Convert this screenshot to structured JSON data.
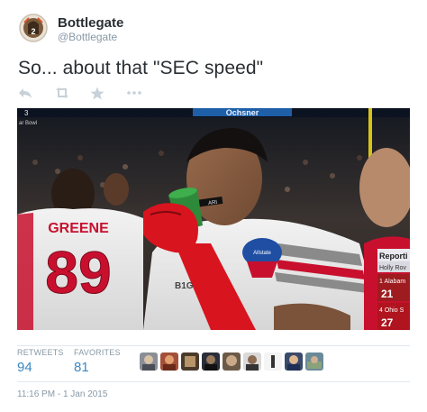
{
  "author": {
    "display_name": "Bottlegate",
    "handle": "@Bottlegate",
    "avatar_icon": "bottle-cap-avatar-icon"
  },
  "tweet": {
    "text": "So... about that \"SEC speed\"",
    "timestamp": "11:16 PM - 1 Jan 2015"
  },
  "actions": [
    {
      "name": "reply-icon"
    },
    {
      "name": "retweet-icon"
    },
    {
      "name": "favorite-icon"
    },
    {
      "name": "more-icon"
    }
  ],
  "media": {
    "stadium_sign": "Ochsner",
    "scoreboard_text": "3",
    "scoreboard_sub": "ar Bowl",
    "jersey_name": "GREENE",
    "jersey_number": "89",
    "eye_black_text": "ARI",
    "sleeve_logo": "B1G",
    "patch_text": "Allstate",
    "overlay": {
      "title": "Reporti",
      "subtitle": "Holly Rov",
      "team1_name": "1 Alabam",
      "team1_score": "21",
      "team2_name": "4 Ohio S",
      "team2_score": "27"
    }
  },
  "stats": {
    "retweets_label": "RETWEETS",
    "retweets_value": "94",
    "favorites_label": "FAVORITES",
    "favorites_value": "81"
  },
  "colors": {
    "link_blue": "#3b88c3",
    "muted_gray": "#8899a6",
    "text_dark": "#292f33",
    "ohio_red": "#c8102e"
  }
}
